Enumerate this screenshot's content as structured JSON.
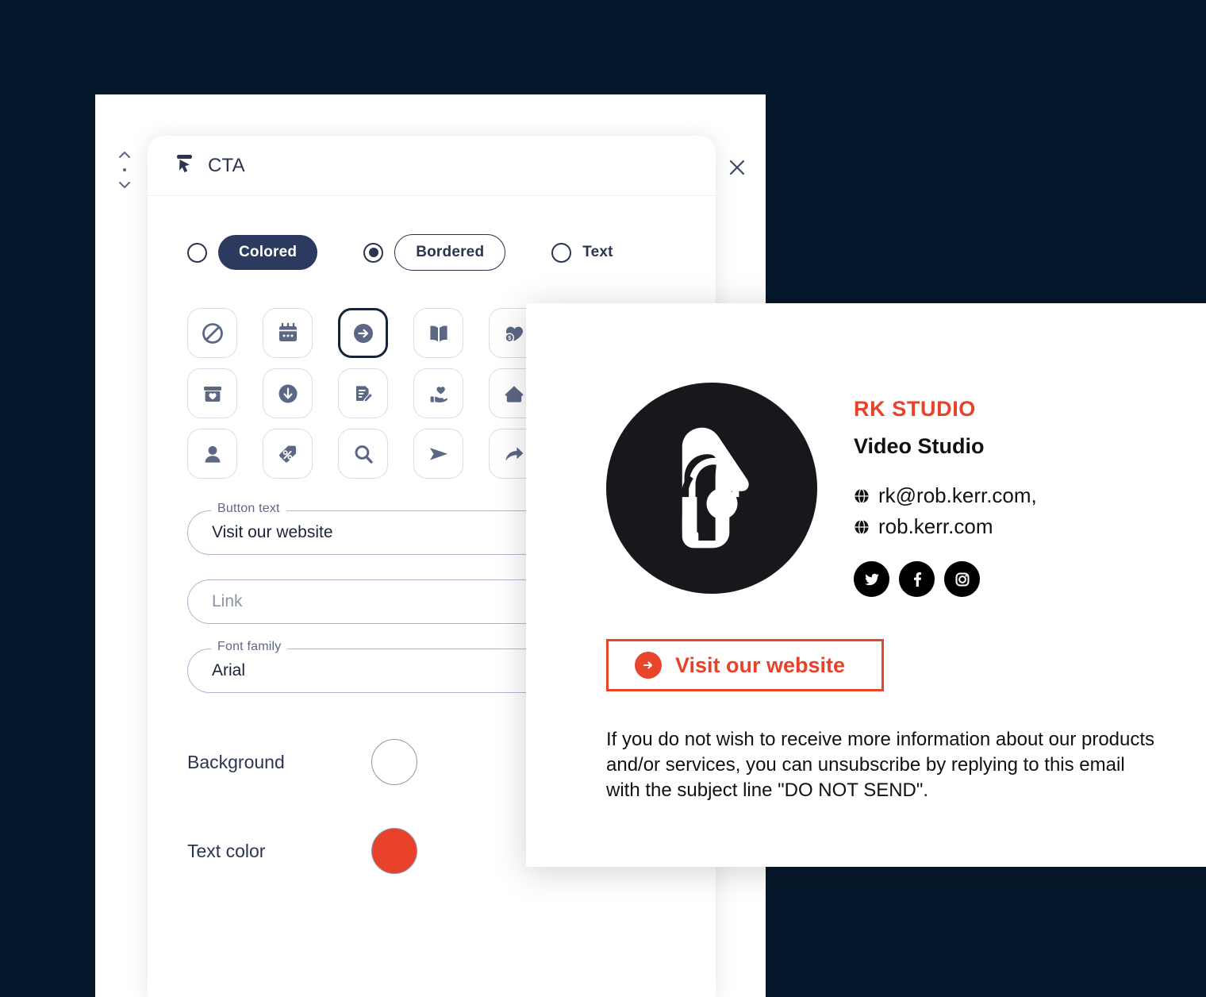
{
  "window": {
    "background_color": "#05182b",
    "panel_background": "#ffffff"
  },
  "editor": {
    "title": "CTA",
    "title_icon": "cursor-pointer-icon",
    "close_icon": "close-icon",
    "drag_handle_icon": "drag-vertical-icon",
    "style_options": [
      {
        "label": "Colored",
        "selected": false,
        "variant": "filled"
      },
      {
        "label": "Bordered",
        "selected": true,
        "variant": "outline"
      },
      {
        "label": "Text",
        "selected": false,
        "variant": "plain"
      }
    ],
    "icon_grid": [
      {
        "name": "no-entry-icon",
        "selected": false
      },
      {
        "name": "calendar-icon",
        "selected": false
      },
      {
        "name": "arrow-right-circle-icon",
        "selected": true
      },
      {
        "name": "open-book-icon",
        "selected": false
      },
      {
        "name": "heart-dollar-icon",
        "selected": false
      },
      {
        "name": "chat-bubble-lines-icon",
        "selected": false
      },
      {
        "name": "box-heart-icon",
        "selected": false
      },
      {
        "name": "download-circle-icon",
        "selected": false
      },
      {
        "name": "document-edit-icon",
        "selected": false
      },
      {
        "name": "hand-heart-icon",
        "selected": false
      },
      {
        "name": "home-icon",
        "selected": false
      },
      {
        "name": "location-pin-icon",
        "selected": false
      },
      {
        "name": "person-icon",
        "selected": false
      },
      {
        "name": "discount-tag-icon",
        "selected": false
      },
      {
        "name": "search-icon",
        "selected": false
      },
      {
        "name": "send-icon",
        "selected": false
      },
      {
        "name": "share-arrow-icon",
        "selected": false
      },
      {
        "name": "shopping-cart-icon",
        "selected": false
      }
    ],
    "fields": [
      {
        "legend": "Button text",
        "value": "Visit our website",
        "placeholder": "",
        "is_placeholder": false
      },
      {
        "legend": "",
        "value": "Link",
        "placeholder": "Link",
        "is_placeholder": true
      },
      {
        "legend": "Font family",
        "value": "Arial",
        "placeholder": "",
        "is_placeholder": false
      }
    ],
    "colors": [
      {
        "label": "Background",
        "value": "#ffffff"
      },
      {
        "label": "Text color",
        "value": "#e8422a"
      }
    ]
  },
  "preview": {
    "logo_icon": "headphones-profile-logo",
    "brand_name": "RK STUDIO",
    "brand_color": "#e8422a",
    "role": "Video Studio",
    "contacts": [
      {
        "icon": "globe-icon",
        "text": "rk@rob.kerr.com,"
      },
      {
        "icon": "globe-icon",
        "text": "rob.kerr.com"
      }
    ],
    "social": [
      {
        "name": "twitter-icon"
      },
      {
        "name": "facebook-icon"
      },
      {
        "name": "instagram-icon"
      }
    ],
    "cta": {
      "label": "Visit our website",
      "icon": "arrow-right-circle-icon",
      "border_color": "#e8452a",
      "text_color": "#e8422a"
    },
    "disclaimer": "If you do not wish to receive more information about our products and/or services, you can unsubscribe by replying to this email with the subject line \"DO NOT SEND\"."
  }
}
